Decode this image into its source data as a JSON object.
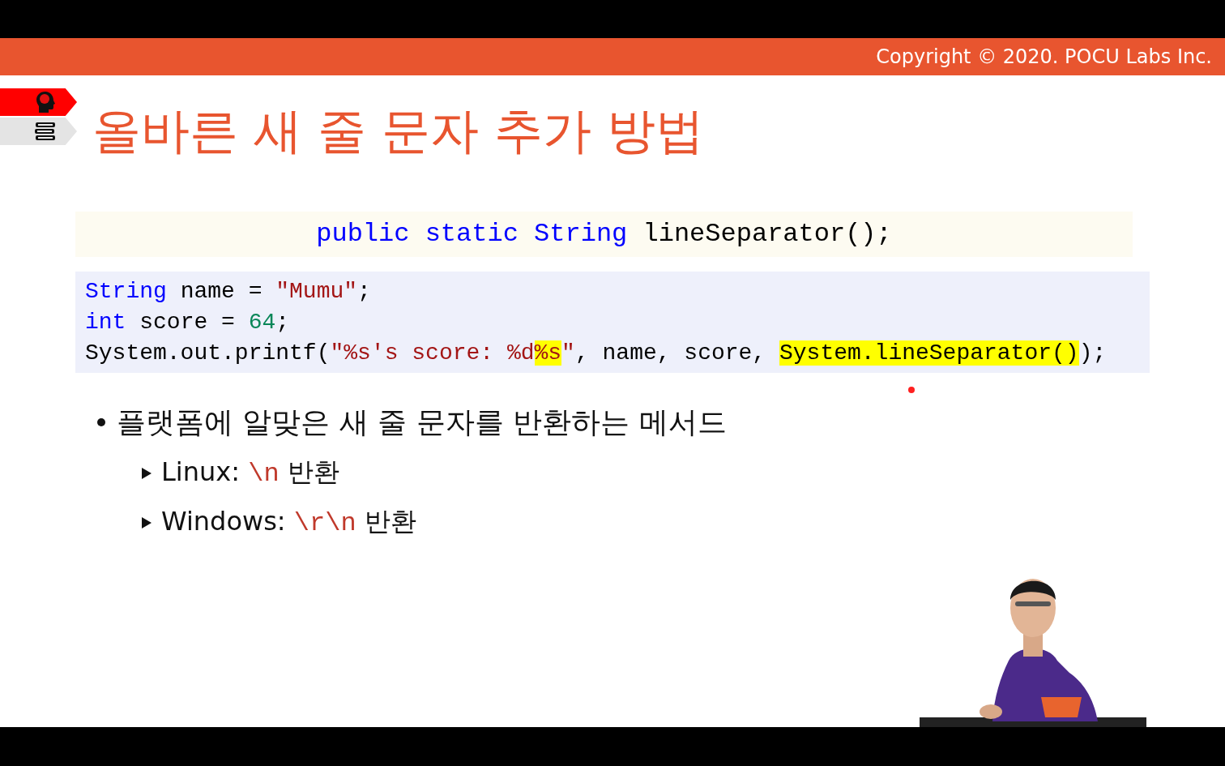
{
  "header": {
    "copyright": "Copyright © 2020. POCU Labs Inc."
  },
  "side_tabs": [
    {
      "kind": "brain",
      "selected": true
    },
    {
      "kind": "books",
      "selected": false
    }
  ],
  "title": "올바른 새 줄 문자 추가 방법",
  "signature": [
    {
      "kind": "keyword",
      "text": "public static String"
    },
    {
      "kind": "plain",
      "text": " lineSeparator();"
    }
  ],
  "code": {
    "lines": [
      [
        {
          "kind": "keyword",
          "text": "String",
          "highlight": false
        },
        {
          "kind": "plain",
          "text": " name = ",
          "highlight": false
        },
        {
          "kind": "string",
          "text": "\"Mumu\"",
          "highlight": false
        },
        {
          "kind": "plain",
          "text": ";",
          "highlight": false
        }
      ],
      [
        {
          "kind": "keyword",
          "text": "int",
          "highlight": false
        },
        {
          "kind": "plain",
          "text": " score = ",
          "highlight": false
        },
        {
          "kind": "number",
          "text": "64",
          "highlight": false
        },
        {
          "kind": "plain",
          "text": ";",
          "highlight": false
        }
      ],
      [
        {
          "kind": "plain",
          "text": "System.out.printf(",
          "highlight": false
        },
        {
          "kind": "string",
          "text": "\"%s's score: %d",
          "highlight": false
        },
        {
          "kind": "string",
          "text": "%s",
          "highlight": true
        },
        {
          "kind": "string",
          "text": "\"",
          "highlight": false
        },
        {
          "kind": "plain",
          "text": ", name, score, ",
          "highlight": false
        },
        {
          "kind": "plain",
          "text": "System.lineSeparator()",
          "highlight": true
        },
        {
          "kind": "plain",
          "text": ");",
          "highlight": false
        }
      ]
    ]
  },
  "bullets": [
    {
      "text": "플랫폼에 알맞은 새 줄 문자를 반환하는 메서드",
      "children": [
        {
          "parts": [
            {
              "kind": "text",
              "text": "Linux: "
            },
            {
              "kind": "code",
              "text": "\\n"
            },
            {
              "kind": "text",
              "text": " 반환"
            }
          ]
        },
        {
          "parts": [
            {
              "kind": "text",
              "text": "Windows: "
            },
            {
              "kind": "code",
              "text": "\\r\\n"
            },
            {
              "kind": "text",
              "text": " 반환"
            }
          ]
        }
      ]
    }
  ]
}
